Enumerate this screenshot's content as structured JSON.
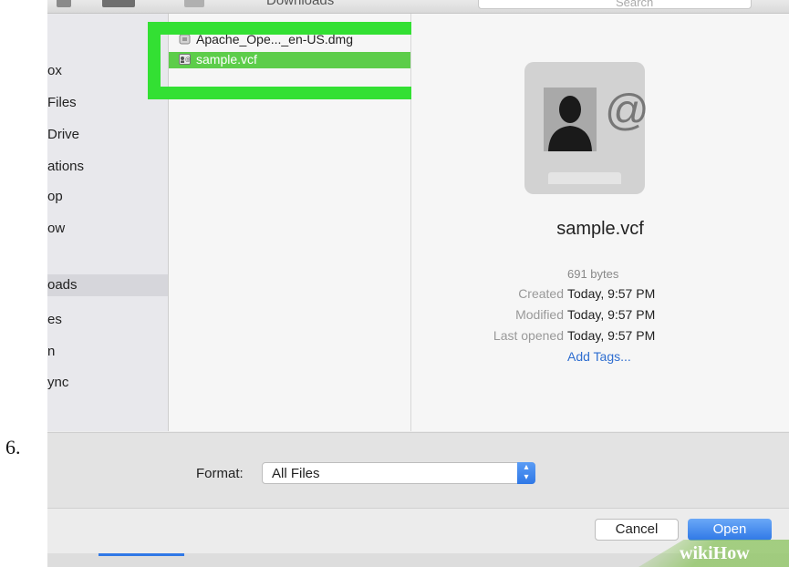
{
  "step": {
    "number": "6."
  },
  "toolbar": {
    "path_label": "Downloads",
    "search_placeholder": "Search"
  },
  "sidebar": {
    "items": [
      {
        "label": "ox"
      },
      {
        "label": "Files"
      },
      {
        "label": "Drive"
      },
      {
        "label": "ations"
      },
      {
        "label": "op"
      },
      {
        "label": "ow"
      },
      {
        "label": "oads",
        "selected": true
      },
      {
        "label": "es"
      },
      {
        "label": "n"
      },
      {
        "label": "ync"
      }
    ]
  },
  "files": [
    {
      "name": "Apache_Ope..._en-US.dmg",
      "icon": "dmg-file-icon"
    },
    {
      "name": "sample.vcf",
      "icon": "vcard-file-icon",
      "selected": true
    }
  ],
  "highlight": {
    "color": "#33e033"
  },
  "preview": {
    "name": "sample.vcf",
    "size": "691 bytes",
    "meta": [
      {
        "label": "Created",
        "value": "Today, 9:57 PM"
      },
      {
        "label": "Modified",
        "value": "Today, 9:57 PM"
      },
      {
        "label": "Last opened",
        "value": "Today, 9:57 PM"
      }
    ],
    "add_tags": "Add Tags..."
  },
  "format": {
    "label": "Format:",
    "value": "All Files"
  },
  "buttons": {
    "cancel": "Cancel",
    "open": "Open"
  },
  "colors": {
    "accent": "#2f78e6",
    "selection": "#5dcd4a",
    "link": "#2f6ed0"
  },
  "watermark": {
    "text": "wikiHow"
  }
}
